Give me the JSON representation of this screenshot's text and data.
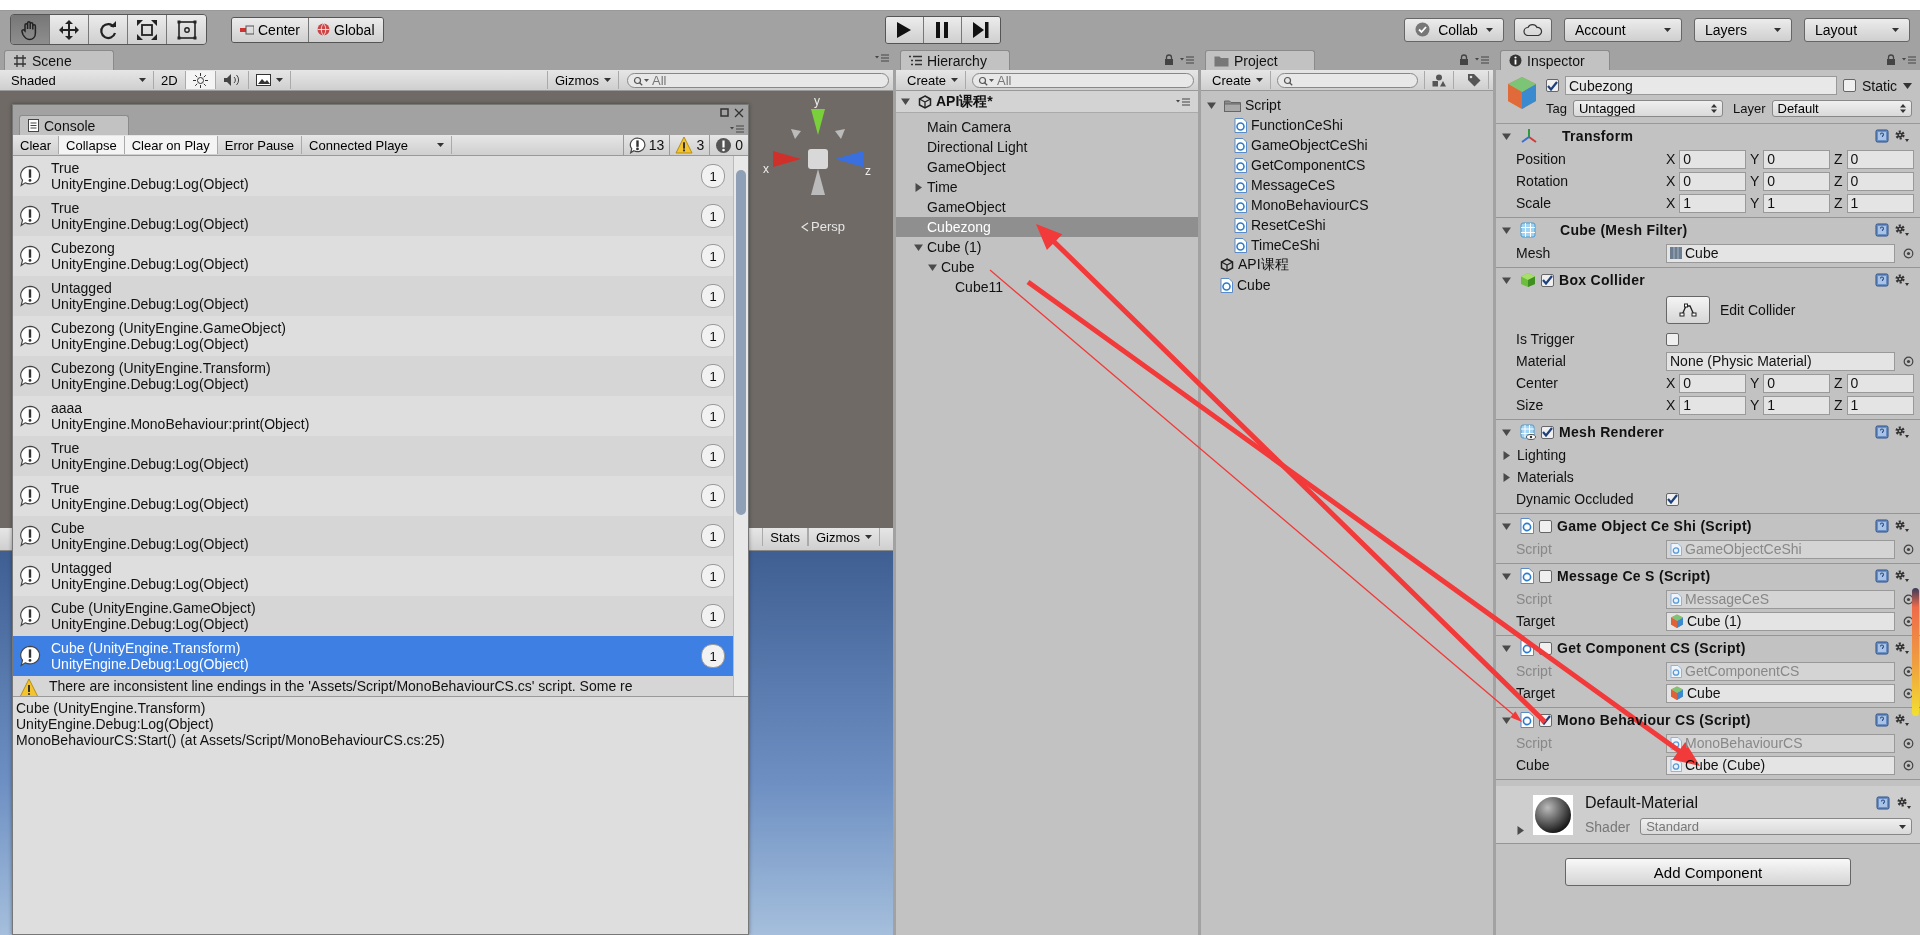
{
  "toolbar": {
    "tools": [
      {
        "kind": "hand",
        "selected": true
      },
      {
        "kind": "move",
        "selected": false
      },
      {
        "kind": "rotate",
        "selected": false
      },
      {
        "kind": "scale",
        "selected": false
      },
      {
        "kind": "rect",
        "selected": false
      }
    ],
    "pivot": [
      {
        "kind": "center",
        "label": "Center"
      },
      {
        "kind": "global",
        "label": "Global"
      }
    ],
    "collab": "Collab",
    "account": "Account",
    "layers": "Layers",
    "layout": "Layout"
  },
  "scene": {
    "tab": "Scene",
    "shading": "Shaded",
    "mode_2d": "2D",
    "toggles": [
      {
        "kind": "lighting",
        "on": true
      },
      {
        "kind": "audio",
        "on": false
      },
      {
        "kind": "effects",
        "on": false
      }
    ],
    "gizmos": "Gizmos",
    "search": {
      "placeholder": "All"
    },
    "axes": [
      "y",
      "x",
      "z"
    ],
    "projection": "Persp"
  },
  "game": {
    "stats": "Stats",
    "gizmos": "Gizmos"
  },
  "console": {
    "title": "Console",
    "buttons": [
      {
        "label": "Clear",
        "on": false
      },
      {
        "label": "Collapse",
        "on": true
      },
      {
        "label": "Clear on Play",
        "on": true
      },
      {
        "label": "Error Pause",
        "on": false
      }
    ],
    "player": "Connected Playe",
    "counters": [
      {
        "kind": "info",
        "count": "13"
      },
      {
        "kind": "warning",
        "count": "3"
      },
      {
        "kind": "error",
        "count": "0"
      }
    ],
    "rows": [
      {
        "kind": "info",
        "line1": "True",
        "line2": "UnityEngine.Debug:Log(Object)",
        "count": "1",
        "selected": false
      },
      {
        "kind": "info",
        "line1": "True",
        "line2": "UnityEngine.Debug:Log(Object)",
        "count": "1",
        "selected": false
      },
      {
        "kind": "info",
        "line1": "Cubezong",
        "line2": "UnityEngine.Debug:Log(Object)",
        "count": "1",
        "selected": false
      },
      {
        "kind": "info",
        "line1": "Untagged",
        "line2": "UnityEngine.Debug:Log(Object)",
        "count": "1",
        "selected": false
      },
      {
        "kind": "info",
        "line1": "Cubezong (UnityEngine.GameObject)",
        "line2": "UnityEngine.Debug:Log(Object)",
        "count": "1",
        "selected": false
      },
      {
        "kind": "info",
        "line1": "Cubezong (UnityEngine.Transform)",
        "line2": "UnityEngine.Debug:Log(Object)",
        "count": "1",
        "selected": false
      },
      {
        "kind": "info",
        "line1": "aaaa",
        "line2": "UnityEngine.MonoBehaviour:print(Object)",
        "count": "1",
        "selected": false
      },
      {
        "kind": "info",
        "line1": "True",
        "line2": "UnityEngine.Debug:Log(Object)",
        "count": "1",
        "selected": false
      },
      {
        "kind": "info",
        "line1": "True",
        "line2": "UnityEngine.Debug:Log(Object)",
        "count": "1",
        "selected": false
      },
      {
        "kind": "info",
        "line1": "Cube",
        "line2": "UnityEngine.Debug:Log(Object)",
        "count": "1",
        "selected": false
      },
      {
        "kind": "info",
        "line1": "Untagged",
        "line2": "UnityEngine.Debug:Log(Object)",
        "count": "1",
        "selected": false
      },
      {
        "kind": "info",
        "line1": "Cube (UnityEngine.GameObject)",
        "line2": "UnityEngine.Debug:Log(Object)",
        "count": "1",
        "selected": false
      },
      {
        "kind": "info",
        "line1": "Cube (UnityEngine.Transform)",
        "line2": "UnityEngine.Debug:Log(Object)",
        "count": "1",
        "selected": true
      },
      {
        "kind": "warning",
        "line1": "There are inconsistent line endings in the 'Assets/Script/MonoBehaviourCS.cs' script. Some re",
        "selected": false
      }
    ],
    "detail": [
      "Cube (UnityEngine.Transform)",
      "UnityEngine.Debug:Log(Object)",
      "MonoBehaviourCS:Start() (at Assets/Script/MonoBehaviourCS.cs:25)"
    ]
  },
  "hierarchy": {
    "tab": "Hierarchy",
    "create": "Create",
    "search": {
      "placeholder": "All"
    },
    "scene": "API课程*",
    "items": [
      {
        "label": "Main Camera",
        "selected": false
      },
      {
        "label": "Directional Light",
        "selected": false
      },
      {
        "label": "GameObject",
        "selected": false
      },
      {
        "label": "Time",
        "selected": false,
        "expanded": false
      },
      {
        "label": "GameObject",
        "selected": false
      },
      {
        "label": "Cubezong",
        "selected": true
      },
      {
        "label": "Cube (1)",
        "selected": false,
        "expanded": true,
        "children": [
          {
            "label": "Cube",
            "selected": false,
            "expanded": true,
            "children": [
              {
                "label": "Cube11",
                "selected": false
              }
            ]
          }
        ]
      }
    ]
  },
  "project": {
    "tab": "Project",
    "create": "Create",
    "items": [
      {
        "label": "Script",
        "kind": "folder",
        "expanded": true,
        "children": [
          {
            "label": "FunctionCeShi",
            "kind": "script"
          },
          {
            "label": "GameObjectCeShi",
            "kind": "script"
          },
          {
            "label": "GetComponentCS",
            "kind": "script"
          },
          {
            "label": "MessageCeS",
            "kind": "script"
          },
          {
            "label": "MonoBehaviourCS",
            "kind": "script"
          },
          {
            "label": "ResetCeShi",
            "kind": "script"
          },
          {
            "label": "TimeCeShi",
            "kind": "script"
          }
        ]
      },
      {
        "label": "API课程",
        "kind": "scene"
      },
      {
        "label": "Cube",
        "kind": "script"
      }
    ]
  },
  "inspector": {
    "tab": "Inspector",
    "active": true,
    "enabled": true,
    "name": "Cubezong",
    "static": {
      "label": "Static",
      "checked": false
    },
    "tag": {
      "label": "Tag",
      "value": "Untagged"
    },
    "layer": {
      "label": "Layer",
      "value": "Default"
    },
    "components": [
      {
        "kind": "transform",
        "title": "Transform",
        "rows": [
          {
            "kind": "vec3",
            "label": "Position",
            "axes": [
              {
                "axis": "X",
                "value": "0"
              },
              {
                "axis": "Y",
                "value": "0"
              },
              {
                "axis": "Z",
                "value": "0"
              }
            ]
          },
          {
            "kind": "vec3",
            "label": "Rotation",
            "axes": [
              {
                "axis": "X",
                "value": "0"
              },
              {
                "axis": "Y",
                "value": "0"
              },
              {
                "axis": "Z",
                "value": "0"
              }
            ]
          },
          {
            "kind": "vec3",
            "label": "Scale",
            "axes": [
              {
                "axis": "X",
                "value": "1"
              },
              {
                "axis": "Y",
                "value": "1"
              },
              {
                "axis": "Z",
                "value": "1"
              }
            ]
          }
        ]
      },
      {
        "kind": "meshfilter",
        "title": "Cube (Mesh Filter)",
        "rows": [
          {
            "kind": "mesh",
            "label": "Mesh",
            "value": "Cube",
            "disabled": false
          }
        ]
      },
      {
        "kind": "collider",
        "title": "Box Collider",
        "enabled": true,
        "rows": [
          {
            "kind": "button",
            "label": "Edit Collider"
          },
          {
            "kind": "checkbox",
            "label": "Is Trigger",
            "checked": false
          },
          {
            "kind": "asset",
            "label": "Material",
            "value": "None (Physic Material)",
            "disabled": false
          },
          {
            "kind": "vec3",
            "label": "Center",
            "axes": [
              {
                "axis": "X",
                "value": "0"
              },
              {
                "axis": "Y",
                "value": "0"
              },
              {
                "axis": "Z",
                "value": "0"
              }
            ]
          },
          {
            "kind": "vec3",
            "label": "Size",
            "axes": [
              {
                "axis": "X",
                "value": "1"
              },
              {
                "axis": "Y",
                "value": "1"
              },
              {
                "axis": "Z",
                "value": "1"
              }
            ]
          }
        ]
      },
      {
        "kind": "renderer",
        "title": "Mesh Renderer",
        "enabled": true,
        "rows": [
          {
            "kind": "foldout",
            "label": "Lighting",
            "expanded": false
          },
          {
            "kind": "foldout",
            "label": "Materials",
            "expanded": false
          },
          {
            "kind": "checkbox",
            "label": "Dynamic Occluded",
            "checked": true
          }
        ]
      },
      {
        "kind": "script",
        "title": "Game Object Ce Shi (Script)",
        "enabled": false,
        "rows": [
          {
            "kind": "script",
            "label": "Script",
            "value": "GameObjectCeShi",
            "disabled": true
          }
        ]
      },
      {
        "kind": "script",
        "title": "Message Ce S (Script)",
        "enabled": false,
        "rows": [
          {
            "kind": "script",
            "label": "Script",
            "value": "MessageCeS",
            "disabled": true
          },
          {
            "kind": "gameobject",
            "label": "Target",
            "value": "Cube (1)",
            "disabled": false
          }
        ]
      },
      {
        "kind": "script",
        "title": "Get Component CS (Script)",
        "enabled": false,
        "rows": [
          {
            "kind": "script",
            "label": "Script",
            "value": "GetComponentCS",
            "disabled": true
          },
          {
            "kind": "gameobject",
            "label": "Target",
            "value": "Cube",
            "disabled": false
          }
        ]
      },
      {
        "kind": "script",
        "title": "Mono Behaviour CS (Script)",
        "enabled": true,
        "rows": [
          {
            "kind": "script",
            "label": "Script",
            "value": "MonoBehaviourCS",
            "disabled": true
          },
          {
            "kind": "script",
            "label": "Cube",
            "value": "Cube (Cube)",
            "disabled": false
          }
        ]
      }
    ],
    "material": {
      "name": "Default-Material",
      "shader_label": "Shader",
      "shader": "Standard"
    },
    "add_component": "Add Component"
  }
}
